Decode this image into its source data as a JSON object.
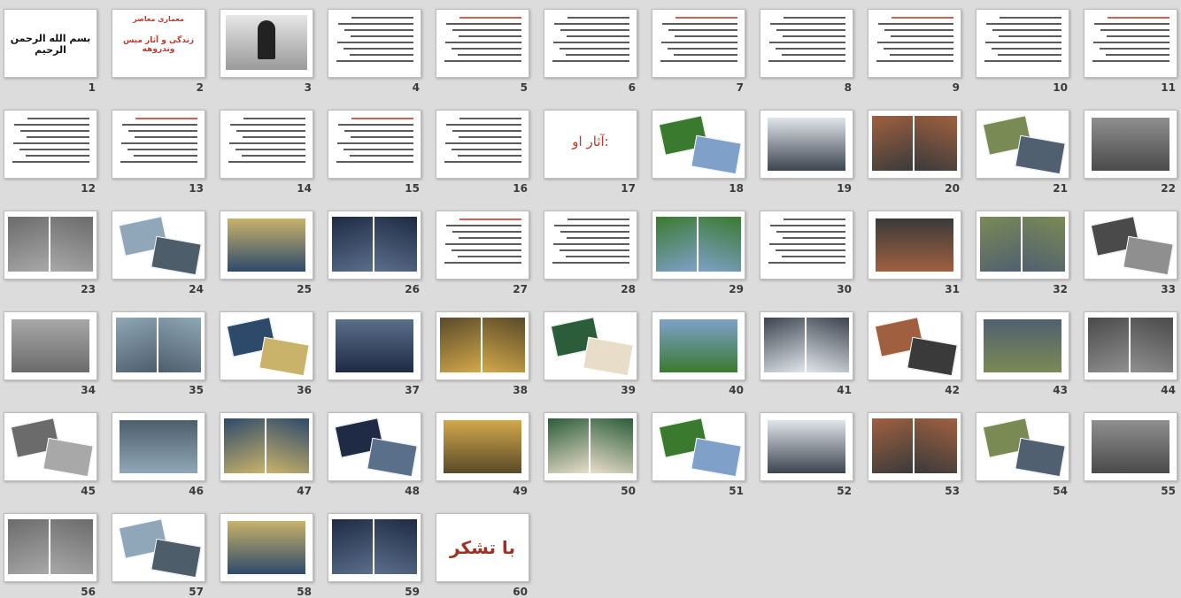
{
  "slides": [
    {
      "num": "1",
      "kind": "calligraphy",
      "text": "بسم الله الرحمن الرحیم"
    },
    {
      "num": "2",
      "kind": "title",
      "title": "معماری معاصر",
      "subtitle": "زندگی و آثار میس وندروهه"
    },
    {
      "num": "3",
      "kind": "portrait"
    },
    {
      "num": "4",
      "kind": "text"
    },
    {
      "num": "5",
      "kind": "text"
    },
    {
      "num": "6",
      "kind": "text"
    },
    {
      "num": "7",
      "kind": "text"
    },
    {
      "num": "8",
      "kind": "text"
    },
    {
      "num": "9",
      "kind": "text"
    },
    {
      "num": "10",
      "kind": "text"
    },
    {
      "num": "11",
      "kind": "text"
    },
    {
      "num": "12",
      "kind": "text"
    },
    {
      "num": "13",
      "kind": "text"
    },
    {
      "num": "14",
      "kind": "text"
    },
    {
      "num": "15",
      "kind": "text"
    },
    {
      "num": "16",
      "kind": "text"
    },
    {
      "num": "17",
      "kind": "heading",
      "text": "آثار او:"
    },
    {
      "num": "18",
      "kind": "photo"
    },
    {
      "num": "19",
      "kind": "photo"
    },
    {
      "num": "20",
      "kind": "photo"
    },
    {
      "num": "21",
      "kind": "photo"
    },
    {
      "num": "22",
      "kind": "photo"
    },
    {
      "num": "23",
      "kind": "photo"
    },
    {
      "num": "24",
      "kind": "photo"
    },
    {
      "num": "25",
      "kind": "photo"
    },
    {
      "num": "26",
      "kind": "photo"
    },
    {
      "num": "27",
      "kind": "text"
    },
    {
      "num": "28",
      "kind": "text"
    },
    {
      "num": "29",
      "kind": "photo"
    },
    {
      "num": "30",
      "kind": "text"
    },
    {
      "num": "31",
      "kind": "photo"
    },
    {
      "num": "32",
      "kind": "photo"
    },
    {
      "num": "33",
      "kind": "photo"
    },
    {
      "num": "34",
      "kind": "photo"
    },
    {
      "num": "35",
      "kind": "photo"
    },
    {
      "num": "36",
      "kind": "photo"
    },
    {
      "num": "37",
      "kind": "photo"
    },
    {
      "num": "38",
      "kind": "photo"
    },
    {
      "num": "39",
      "kind": "photo"
    },
    {
      "num": "40",
      "kind": "photo"
    },
    {
      "num": "41",
      "kind": "photo"
    },
    {
      "num": "42",
      "kind": "photo"
    },
    {
      "num": "43",
      "kind": "photo"
    },
    {
      "num": "44",
      "kind": "photo"
    },
    {
      "num": "45",
      "kind": "photo"
    },
    {
      "num": "46",
      "kind": "photo"
    },
    {
      "num": "47",
      "kind": "photo"
    },
    {
      "num": "48",
      "kind": "photo"
    },
    {
      "num": "49",
      "kind": "photo"
    },
    {
      "num": "50",
      "kind": "photo"
    },
    {
      "num": "51",
      "kind": "photo"
    },
    {
      "num": "52",
      "kind": "photo"
    },
    {
      "num": "53",
      "kind": "photo"
    },
    {
      "num": "54",
      "kind": "photo"
    },
    {
      "num": "55",
      "kind": "photo"
    },
    {
      "num": "56",
      "kind": "photo"
    },
    {
      "num": "57",
      "kind": "photo"
    },
    {
      "num": "58",
      "kind": "photo"
    },
    {
      "num": "59",
      "kind": "photo"
    },
    {
      "num": "60",
      "kind": "thanks",
      "text": "با تشکر"
    }
  ],
  "colors": {
    "background": "#dcdcdc",
    "accent_red": "#c0392b",
    "number_text": "#3a3a3a"
  }
}
